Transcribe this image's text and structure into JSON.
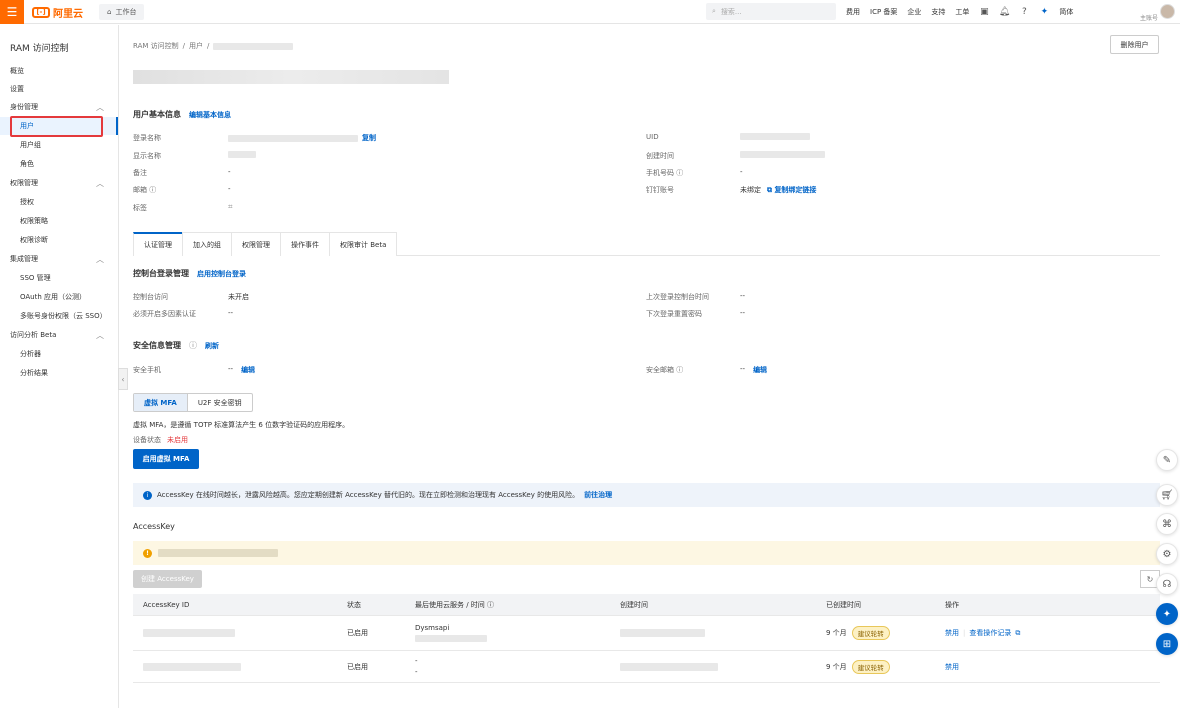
{
  "topbar": {
    "logo_text": "阿里云",
    "workbench": "工作台",
    "search_placeholder": "搜索...",
    "links": [
      "费用",
      "ICP 备案",
      "企业",
      "支持",
      "工单"
    ],
    "lang": "简体",
    "account_type": "主账号"
  },
  "sidebar": {
    "title": "RAM 访问控制",
    "items": [
      {
        "label": "概览",
        "level": 1
      },
      {
        "label": "设置",
        "level": 1
      },
      {
        "label": "身份管理",
        "level": 1,
        "group": true
      },
      {
        "label": "用户",
        "level": 2,
        "active": true
      },
      {
        "label": "用户组",
        "level": 2
      },
      {
        "label": "角色",
        "level": 2
      },
      {
        "label": "权限管理",
        "level": 1,
        "group": true
      },
      {
        "label": "授权",
        "level": 2
      },
      {
        "label": "权限策略",
        "level": 2
      },
      {
        "label": "权限诊断",
        "level": 2
      },
      {
        "label": "集成管理",
        "level": 1,
        "group": true
      },
      {
        "label": "SSO 管理",
        "level": 2
      },
      {
        "label": "OAuth 应用（公测）",
        "level": 2
      },
      {
        "label": "多账号身份权限（云 SSO）",
        "level": 2
      },
      {
        "label": "访问分析 Beta",
        "level": 1,
        "group": true
      },
      {
        "label": "分析器",
        "level": 2
      },
      {
        "label": "分析结果",
        "level": 2
      }
    ]
  },
  "breadcrumb": [
    "RAM 访问控制",
    "/",
    "用户",
    "/"
  ],
  "delete_user": "删除用户",
  "basic_info": {
    "title": "用户基本信息",
    "edit": "编辑基本信息",
    "login_name_label": "登录名称",
    "copy": "复制",
    "display_name_label": "显示名称",
    "remark_label": "备注",
    "remark_value": "-",
    "email_label": "邮箱",
    "email_value": "-",
    "tags_label": "标签",
    "uid_label": "UID",
    "created_label": "创建时间",
    "phone_label": "手机号码",
    "phone_value": "-",
    "dingtalk_label": "钉钉账号",
    "dingtalk_value": "未绑定",
    "dingtalk_link": "复制绑定链接"
  },
  "tabs": [
    "认证管理",
    "加入的组",
    "权限管理",
    "操作事件",
    "权限审计 Beta"
  ],
  "console_login": {
    "title": "控制台登录管理",
    "enable": "启用控制台登录",
    "access_label": "控制台访问",
    "access_value": "未开启",
    "mfa_label": "必须开启多因素认证",
    "mfa_value": "--",
    "last_login_label": "上次登录控制台时间",
    "last_login_value": "--",
    "reset_pw_label": "下次登录重置密码",
    "reset_pw_value": "--"
  },
  "security": {
    "title": "安全信息管理",
    "refresh": "刷新",
    "phone_label": "安全手机",
    "phone_value": "--",
    "email_label": "安全邮箱",
    "email_value": "--",
    "edit": "编辑"
  },
  "mfa": {
    "seg_virtual": "虚拟 MFA",
    "seg_u2f": "U2F 安全密钥",
    "desc": "虚拟 MFA，是遵循 TOTP 标准算法产生 6 位数字验证码的应用程序。",
    "status_label": "设备状态",
    "status_value": "未启用",
    "enable_btn": "启用虚拟 MFA"
  },
  "info_notice": {
    "text": "AccessKey 在线时间越长，泄露风险越高。您应定期创建新 AccessKey 替代旧的。现在立即检测和治理现有 AccessKey 的使用风险。",
    "link": "前往治理"
  },
  "accesskey": {
    "title": "AccessKey",
    "create_btn": "创建 AccessKey",
    "columns": [
      "AccessKey ID",
      "状态",
      "最后使用云服务 / 时间",
      "创建时间",
      "已创建时间",
      "操作"
    ],
    "rows": [
      {
        "status": "已启用",
        "service": "Dysmsapi",
        "age": "9 个月",
        "badge": "建议轮转",
        "action1": "禁用",
        "action2": "查看操作记录"
      },
      {
        "status": "已启用",
        "service": "-",
        "service2": "-",
        "age": "9 个月",
        "badge": "建议轮转",
        "action1": "禁用"
      }
    ]
  },
  "colors": {
    "accent": "#0064c8",
    "brand": "#ff6a00",
    "danger": "#e4393c"
  }
}
